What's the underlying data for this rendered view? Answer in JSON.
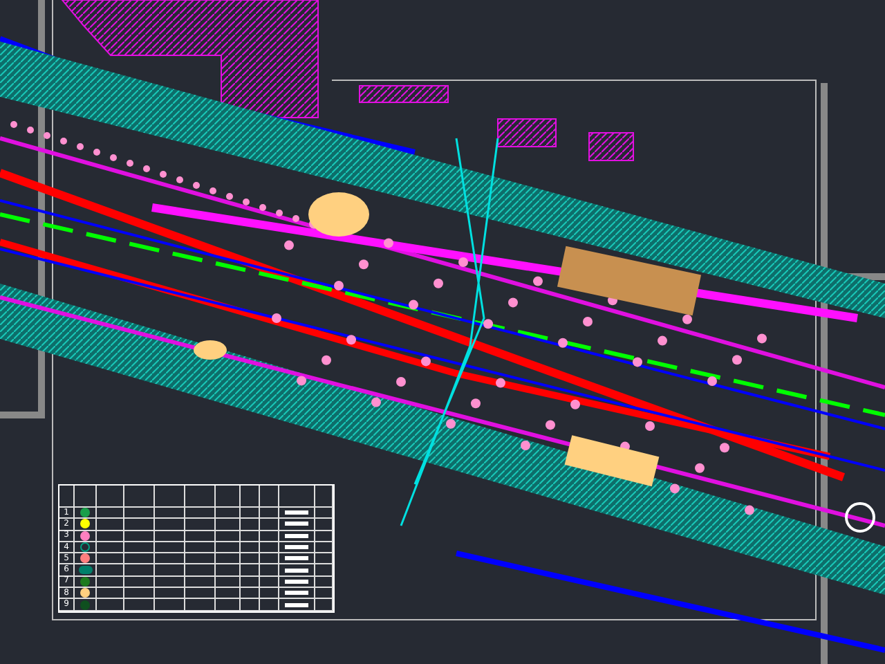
{
  "legend": {
    "rows": [
      {
        "number": "1",
        "kind": "dot",
        "color": "#1a9e4a"
      },
      {
        "number": "2",
        "kind": "dot",
        "color": "#ffff00"
      },
      {
        "number": "3",
        "kind": "dot",
        "color": "#ff80c0"
      },
      {
        "number": "4",
        "kind": "ring",
        "color": "#00a080"
      },
      {
        "number": "5",
        "kind": "dot",
        "color": "#ff7f7f"
      },
      {
        "number": "6",
        "kind": "cluster",
        "color": "#00806a"
      },
      {
        "number": "7",
        "kind": "dot",
        "color": "#1e7a1e"
      },
      {
        "number": "8",
        "kind": "dot",
        "color": "#ffd080"
      },
      {
        "number": "9",
        "kind": "dot",
        "color": "#0f4f1f"
      }
    ]
  }
}
